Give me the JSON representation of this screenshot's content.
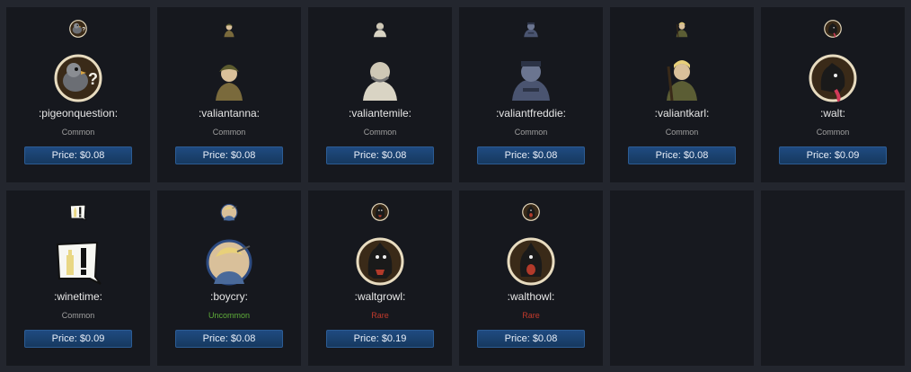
{
  "emotes": [
    {
      "name": ":pigeonquestion:",
      "rarity": "Common",
      "rarity_class": "common",
      "price": "Price: $0.08",
      "icon": "pigeon-question-icon"
    },
    {
      "name": ":valiantanna:",
      "rarity": "Common",
      "rarity_class": "common",
      "price": "Price: $0.08",
      "icon": "valiant-anna-icon"
    },
    {
      "name": ":valiantemile:",
      "rarity": "Common",
      "rarity_class": "common",
      "price": "Price: $0.08",
      "icon": "valiant-emile-icon"
    },
    {
      "name": ":valiantfreddie:",
      "rarity": "Common",
      "rarity_class": "common",
      "price": "Price: $0.08",
      "icon": "valiant-freddie-icon"
    },
    {
      "name": ":valiantkarl:",
      "rarity": "Common",
      "rarity_class": "common",
      "price": "Price: $0.08",
      "icon": "valiant-karl-icon"
    },
    {
      "name": ":walt:",
      "rarity": "Common",
      "rarity_class": "common",
      "price": "Price: $0.09",
      "icon": "walt-dog-icon"
    },
    {
      "name": ":winetime:",
      "rarity": "Common",
      "rarity_class": "common",
      "price": "Price: $0.09",
      "icon": "wine-time-icon"
    },
    {
      "name": ":boycry:",
      "rarity": "Uncommon",
      "rarity_class": "uncommon",
      "price": "Price: $0.08",
      "icon": "boy-cry-icon"
    },
    {
      "name": ":waltgrowl:",
      "rarity": "Rare",
      "rarity_class": "rare",
      "price": "Price: $0.19",
      "icon": "walt-growl-icon"
    },
    {
      "name": ":walthowl:",
      "rarity": "Rare",
      "rarity_class": "rare",
      "price": "Price: $0.08",
      "icon": "walt-howl-icon"
    }
  ],
  "colors": {
    "page_bg": "#23262e",
    "card_bg": "#16181e",
    "button_bg": "#1f4a80",
    "common": "#a0a0a0",
    "uncommon": "#5fae3a",
    "rare": "#c23a2c"
  }
}
